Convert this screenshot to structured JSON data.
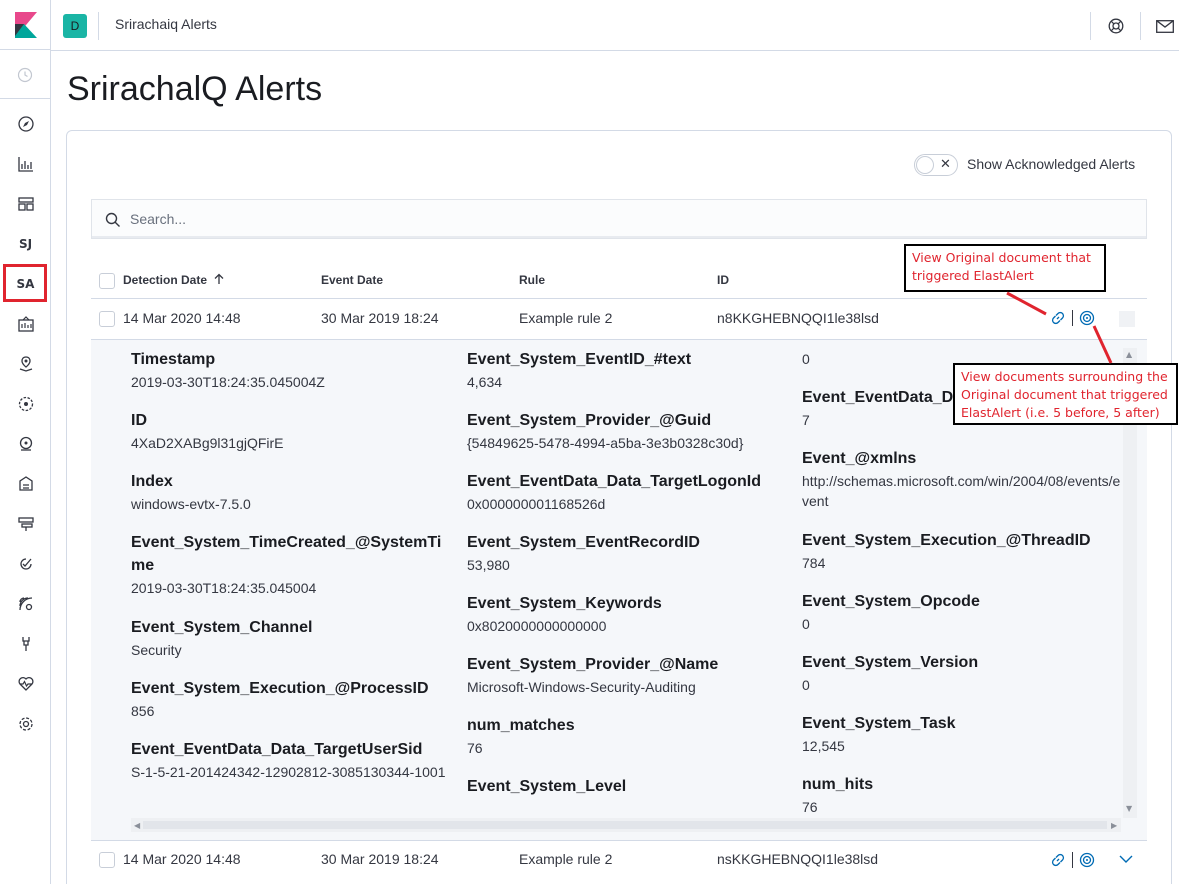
{
  "sidebar": {
    "items": [
      {
        "icon": "discover-icon"
      },
      {
        "icon": "visualize-icon"
      },
      {
        "icon": "dashboard-icon"
      },
      {
        "text": "SJ"
      },
      {
        "text": "SA"
      },
      {
        "icon": "canvas-icon"
      },
      {
        "icon": "maps-icon"
      },
      {
        "icon": "ml-icon"
      },
      {
        "icon": "infrastructure-icon"
      },
      {
        "icon": "logs-icon"
      },
      {
        "icon": "apm-icon"
      },
      {
        "icon": "uptime-icon"
      },
      {
        "icon": "siem-icon"
      },
      {
        "icon": "dev-tools-icon"
      },
      {
        "icon": "monitoring-icon"
      },
      {
        "icon": "management-icon"
      }
    ]
  },
  "header": {
    "space_initial": "D",
    "breadcrumb": "Srirachaiq Alerts"
  },
  "page": {
    "title": "SrirachalQ Alerts"
  },
  "toggle": {
    "label": "Show Acknowledged Alerts",
    "on": false
  },
  "search": {
    "placeholder": "Search..."
  },
  "table": {
    "columns": [
      "Detection Date",
      "Event Date",
      "Rule",
      "ID"
    ],
    "rows": [
      {
        "detection_date": "14 Mar 2020 14:48",
        "event_date": "30 Mar 2019 18:24",
        "rule": "Example rule 2",
        "id": "n8KKGHEBNQQI1le38lsd"
      },
      {
        "detection_date": "14 Mar 2020 14:48",
        "event_date": "30 Mar 2019 18:24",
        "rule": "Example rule 2",
        "id": "nsKKGHEBNQQI1le38lsd"
      }
    ]
  },
  "details": {
    "col1": [
      {
        "name": "Timestamp",
        "value": "2019-03-30T18:24:35.045004Z"
      },
      {
        "name": "ID",
        "value": "4XaD2XABg9l31gjQFirE"
      },
      {
        "name": "Index",
        "value": "windows-evtx-7.5.0"
      },
      {
        "name": "Event_System_TimeCreated_@SystemTime",
        "value": "2019-03-30T18:24:35.045004"
      },
      {
        "name": "Event_System_Channel",
        "value": "Security"
      },
      {
        "name": "Event_System_Execution_@ProcessID",
        "value": "856"
      },
      {
        "name": "Event_EventData_Data_TargetUserSid",
        "value": "S-1-5-21-201424342-12902812-3085130344-1001"
      }
    ],
    "col2": [
      {
        "name": "Event_System_EventID_#text",
        "value": "4,634"
      },
      {
        "name": "Event_System_Provider_@Guid",
        "value": "{54849625-5478-4994-a5ba-3e3b0328c30d}"
      },
      {
        "name": "Event_EventData_Data_TargetLogonId",
        "value": "0x000000001168526d"
      },
      {
        "name": "Event_System_EventRecordID",
        "value": "53,980"
      },
      {
        "name": "Event_System_Keywords",
        "value": "0x8020000000000000"
      },
      {
        "name": "Event_System_Provider_@Name",
        "value": "Microsoft-Windows-Security-Auditing"
      },
      {
        "name": "num_matches",
        "value": "76"
      },
      {
        "name": "Event_System_Level",
        "value": ""
      }
    ],
    "col3": [
      {
        "name": "",
        "value": "0"
      },
      {
        "name": "Event_EventData_Da",
        "value": "7"
      },
      {
        "name": "Event_@xmlns",
        "value": "http://schemas.microsoft.com/win/2004/08/events/event"
      },
      {
        "name": "Event_System_Execution_@ThreadID",
        "value": "784"
      },
      {
        "name": "Event_System_Opcode",
        "value": "0"
      },
      {
        "name": "Event_System_Version",
        "value": "0"
      },
      {
        "name": "Event_System_Task",
        "value": "12,545"
      },
      {
        "name": "num_hits",
        "value": "76"
      }
    ]
  },
  "annotations": {
    "top": "View Original document that triggered ElastAlert",
    "bottom": "View documents surrounding the Original document that triggered ElastAlert (i.e. 5 before, 5 after)"
  },
  "colors": {
    "accent": "#006bb4",
    "annotation_red": "#e0242e",
    "space_badge": "#1ab5a5"
  }
}
